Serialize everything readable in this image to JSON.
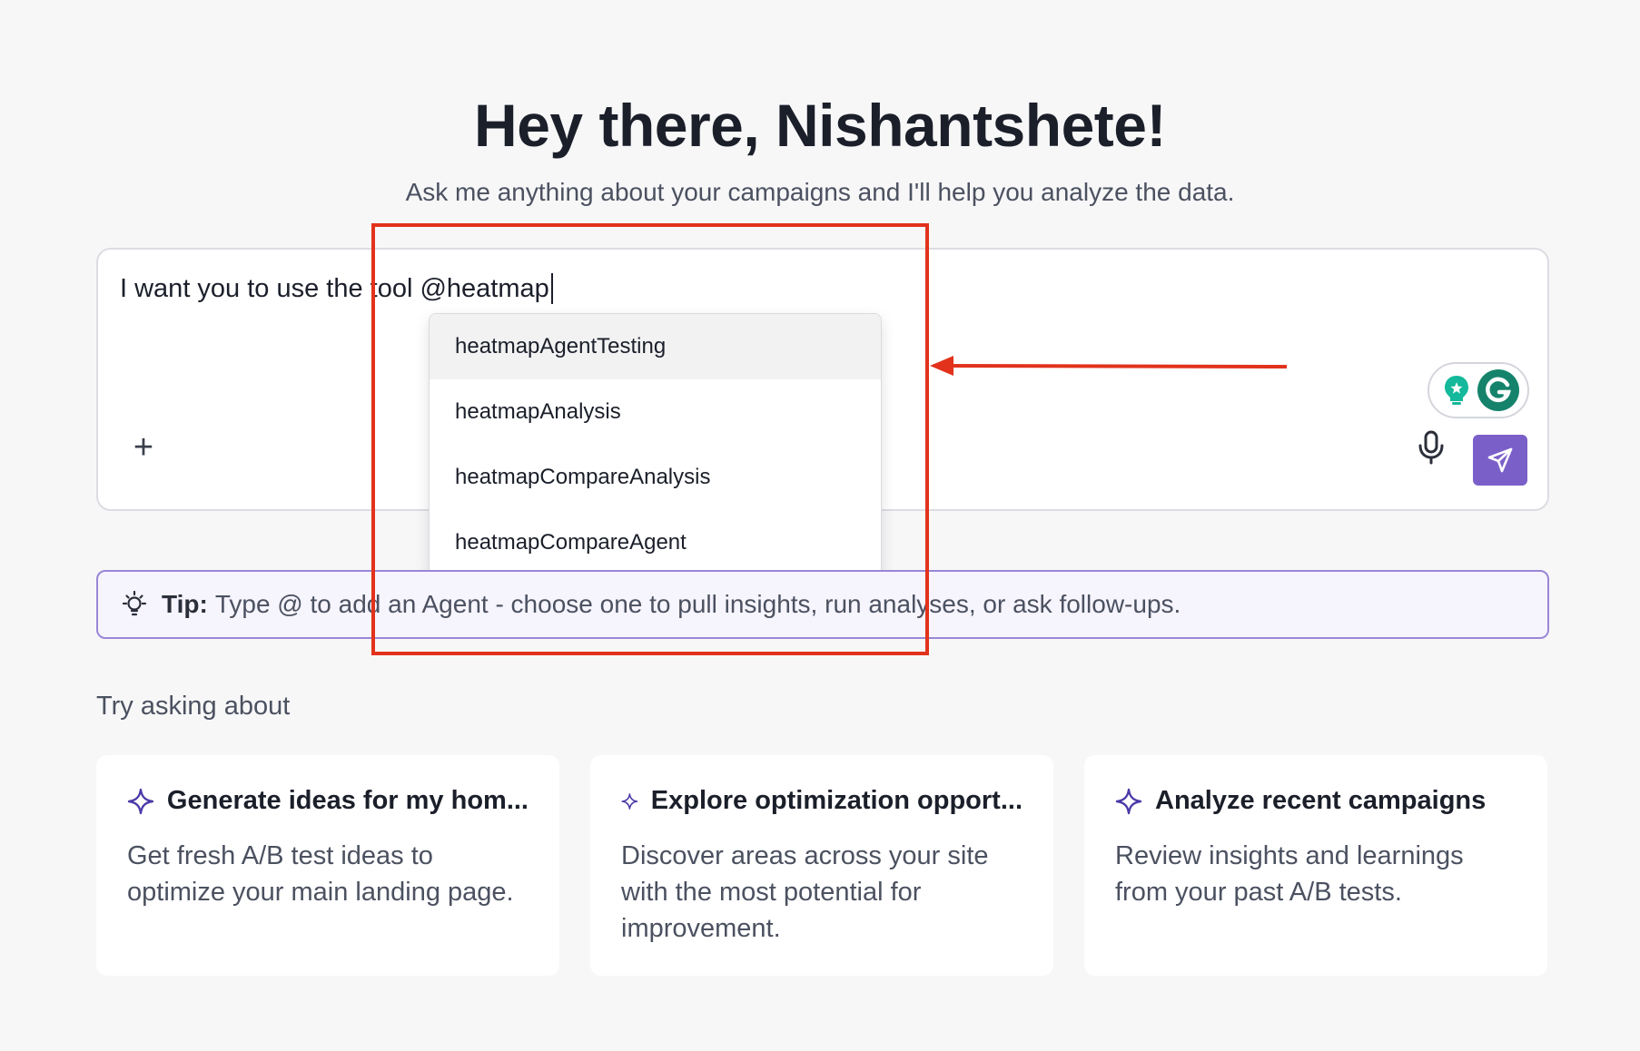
{
  "header": {
    "title": "Hey there, Nishantshete!",
    "subtitle": "Ask me anything about your campaigns and I'll help you analyze the data."
  },
  "composer": {
    "text": "I want you to use the tool @heatmap",
    "plus_label": "+",
    "mic_icon": "microphone-icon",
    "send_icon": "send-icon",
    "send_color": "#7b5fc9",
    "extension_icons": [
      "lightbulb-icon",
      "grammarly-icon"
    ]
  },
  "dropdown": {
    "items": [
      {
        "label": "heatmapAgentTesting",
        "active": true
      },
      {
        "label": "heatmapAnalysis"
      },
      {
        "label": "heatmapCompareAnalysis"
      },
      {
        "label": "heatmapCompareAgent"
      }
    ]
  },
  "tip": {
    "icon": "lightbulb-icon",
    "label": "Tip:",
    "text": "Type @ to add an Agent - choose one to pull insights, run analyses, or ask follow-ups."
  },
  "suggestions": {
    "heading": "Try asking about",
    "cards": [
      {
        "icon": "sparkle-icon",
        "title": "Generate ideas for my hom...",
        "description": "Get fresh A/B test ideas to optimize your main landing page."
      },
      {
        "icon": "sparkle-icon",
        "title": "Explore optimization opport...",
        "description": "Discover areas across your site with the most potential for improvement."
      },
      {
        "icon": "sparkle-icon",
        "title": "Analyze recent campaigns",
        "description": "Review insights and learnings from your past A/B tests."
      }
    ]
  },
  "colors": {
    "accent": "#7b5fc9",
    "annotation": "#e2321c",
    "tip_border": "#9a87d6"
  }
}
